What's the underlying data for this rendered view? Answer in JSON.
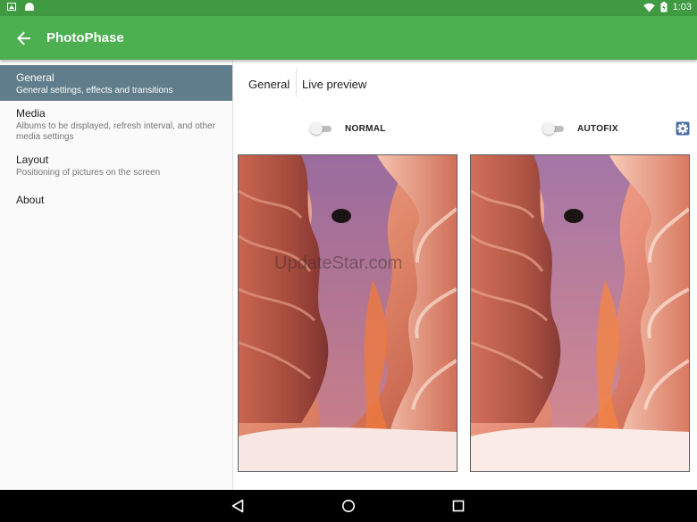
{
  "status_bar": {
    "time": "1:03",
    "icons": [
      "image-notification-icon",
      "android-notification-icon",
      "wifi-icon",
      "battery-charging-icon"
    ]
  },
  "app_bar": {
    "title": "PhotoPhase",
    "back_icon": "arrow-back-icon"
  },
  "sidebar": {
    "items": [
      {
        "title": "General",
        "subtitle": "General settings, effects and transitions",
        "selected": true
      },
      {
        "title": "Media",
        "subtitle": "Albums to be displayed, refresh interval, and other media settings",
        "selected": false
      },
      {
        "title": "Layout",
        "subtitle": "Positioning of pictures on the screen",
        "selected": false
      },
      {
        "title": "About",
        "subtitle": "",
        "selected": false
      }
    ]
  },
  "main": {
    "tabs": [
      {
        "label": "General"
      },
      {
        "label": "Live preview"
      }
    ],
    "left_preview": {
      "toggle_label": "NORMAL",
      "toggle_on": false
    },
    "right_preview": {
      "toggle_label": "AUTOFIX",
      "toggle_on": false
    },
    "settings_icon": "gear-icon",
    "watermark": "UpdateStar.com"
  },
  "nav_bar": {
    "icons": [
      "back-triangle-icon",
      "home-circle-icon",
      "recents-square-icon"
    ]
  },
  "colors": {
    "status_bar": "#3f9a42",
    "app_bar": "#4caf50",
    "selected_item": "#607d8b",
    "gear_icon": "#4a6fa5"
  }
}
